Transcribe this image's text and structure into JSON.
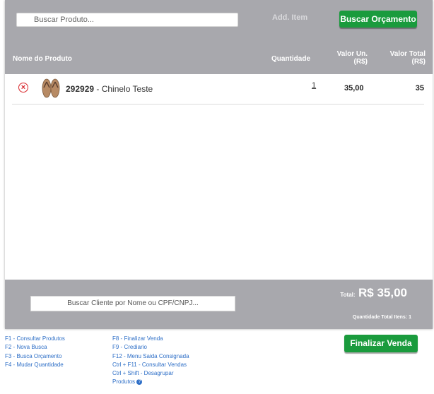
{
  "search": {
    "placeholder": "Buscar Produto..."
  },
  "toolbar": {
    "add_item_label": "Add. Item",
    "buscar_orcamento_label": "Buscar Orçamento"
  },
  "table": {
    "headers": {
      "name": "Nome do Produto",
      "quantity": "Quantidade",
      "unit_value_line1": "Valor Un.",
      "unit_value_line2": "(R$)",
      "total_value_line1": "Valor Total",
      "total_value_line2": "(R$)"
    },
    "rows": [
      {
        "code": "292929",
        "separator": " - ",
        "name": "Chinelo Teste",
        "quantity": "1",
        "unit_value": "35,00",
        "total_value": "35"
      }
    ]
  },
  "footer": {
    "client_search_label": "Buscar Cliente por Nome ou CPF/CNPJ...",
    "total_label": "Total:",
    "total_value": "R$ 35,00",
    "quantity_total_label": "Quantidade Total Itens: 1"
  },
  "shortcuts": {
    "col1": [
      "F1 - Consultar Produtos",
      "F2 - Nova Busca",
      "F3 - Busca Orçamento",
      "F4 - Mudar Quantidade"
    ],
    "col2": [
      "F8 - Finalizar Venda",
      "F9 - Crediario",
      "F12 - Menu Saida Consignada",
      "Ctrl + F11 - Consultar Vendas",
      "Ctrl + Shift - Desagrupar",
      "Produtos"
    ]
  },
  "finalizar_label": "Finalizar Venda",
  "icons": {
    "remove": "remove-circle-icon",
    "help": "help-icon"
  },
  "colors": {
    "accent_green": "#1a9b3d",
    "bar_gray": "#a8a8ad",
    "link_blue": "#2e6fc7",
    "remove_red": "#d8262b"
  }
}
